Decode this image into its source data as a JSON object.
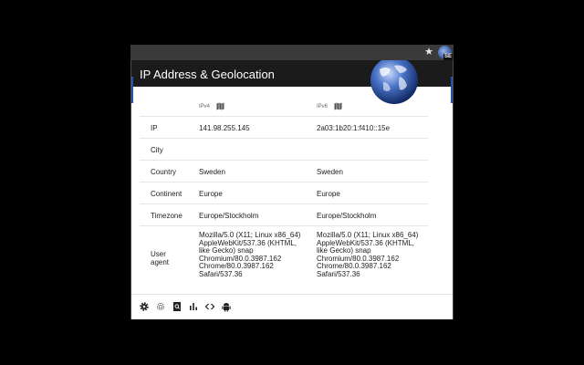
{
  "toolbar": {
    "star_icon": "star-icon",
    "extension_badge": "SE"
  },
  "popup": {
    "title": "IP Address & Geolocation",
    "globe_icon": "globe-icon"
  },
  "table": {
    "headers": {
      "v4": "IPv4",
      "v6": "IPv6",
      "map_icon": "map-icon"
    },
    "rows": [
      {
        "label": "IP",
        "v4": "141.98.255.145",
        "v6": "2a03:1b20:1:f410::15e"
      },
      {
        "label": "City",
        "v4": "",
        "v6": ""
      },
      {
        "label": "Country",
        "v4": "Sweden",
        "v6": "Sweden"
      },
      {
        "label": "Continent",
        "v4": "Europe",
        "v6": "Europe"
      },
      {
        "label": "Timezone",
        "v4": "Europe/Stockholm",
        "v6": "Europe/Stockholm"
      },
      {
        "label": "User agent",
        "v4": "Mozilla/5.0 (X11; Linux x86_64) AppleWebKit/537.36 (KHTML, like Gecko) snap Chromium/80.0.3987.162 Chrome/80.0.3987.162 Safari/537.36",
        "v6": "Mozilla/5.0 (X11; Linux x86_64) AppleWebKit/537.36 (KHTML, like Gecko) snap Chromium/80.0.3987.162 Chrome/80.0.3987.162 Safari/537.36"
      }
    ]
  },
  "footer": {
    "icons": [
      "gear-icon",
      "fingerprint-icon",
      "search-document-icon",
      "bar-chart-icon",
      "code-icon",
      "android-icon"
    ]
  }
}
